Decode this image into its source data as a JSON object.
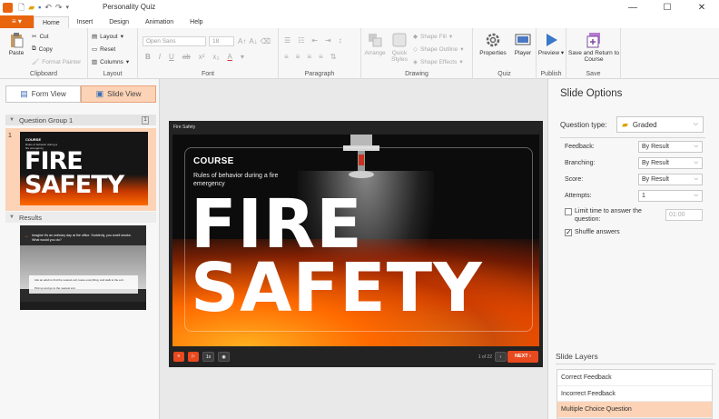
{
  "window": {
    "title": "Personality Quiz",
    "controls": [
      "—",
      "☐",
      "✕"
    ]
  },
  "tabs": {
    "file_icon": "≡",
    "items": [
      {
        "label": "Home"
      },
      {
        "label": "Insert"
      },
      {
        "label": "Design"
      },
      {
        "label": "Animation"
      },
      {
        "label": "Help"
      }
    ]
  },
  "ribbon": {
    "clipboard": {
      "label": "Clipboard",
      "paste": "Paste",
      "cut": "Cut",
      "copy": "Copy",
      "format_painter": "Format Painter"
    },
    "layout": {
      "label": "Layout",
      "layout": "Layout",
      "reset": "Reset",
      "columns": "Columns"
    },
    "font": {
      "label": "Font",
      "family": "Open Sans",
      "size": "18"
    },
    "paragraph": {
      "label": "Paragraph"
    },
    "drawing": {
      "label": "Drawing",
      "arrange": "Arrange",
      "quick_styles": "Quick Styles",
      "shape_fill": "Shape Fill",
      "shape_outline": "Shape Outline",
      "shape_effects": "Shape Effects"
    },
    "quiz": {
      "label": "Quiz",
      "properties": "Properties",
      "player": "Player"
    },
    "publish": {
      "label": "Publish",
      "preview": "Preview"
    },
    "save": {
      "label": "Save",
      "save_return": "Save and Return to Course"
    }
  },
  "left_panel": {
    "form_view": "Form View",
    "slide_view": "Slide View",
    "groups": [
      {
        "title": "Question Group 1",
        "count": "1"
      },
      {
        "title": "Results"
      }
    ],
    "slides": [
      {
        "number": "1",
        "title": "COURSE",
        "subtitle": "Rules of behavior during a fire emergency",
        "big_line1": "FIRE",
        "big_line2": "SAFETY"
      }
    ],
    "results_thumb": {
      "question": "Imagine it's an ordinary day at the office. Suddenly, you smell smoke. What would you do?",
      "option1": "Ask an adult to find the nearest exit, leave everything, and walk to the exit.",
      "option2": "Pick up and go to the nearest exit."
    }
  },
  "canvas": {
    "player_title": "Fire Safety",
    "course": "COURSE",
    "subtitle": "Rules of behavior during a fire emergency",
    "big_line1": "FIRE",
    "big_line2": "SAFETY",
    "speed": "1x",
    "pager": "1 of 22",
    "next": "NEXT"
  },
  "right_panel": {
    "title": "Slide Options",
    "question_type_label": "Question type:",
    "question_type_value": "Graded",
    "options": [
      {
        "label": "Feedback:",
        "value": "By Result"
      },
      {
        "label": "Branching:",
        "value": "By Result"
      },
      {
        "label": "Score:",
        "value": "By Result"
      },
      {
        "label": "Attempts:",
        "value": "1"
      }
    ],
    "limit_time_label": "Limit time to answer the question:",
    "limit_time_value": "01:00",
    "shuffle_label": "Shuffle answers",
    "layers_title": "Slide Layers",
    "layers": [
      {
        "label": "Correct Feedback"
      },
      {
        "label": "Incorrect Feedback"
      },
      {
        "label": "Multiple Choice Question"
      }
    ]
  },
  "colors": {
    "accent": "#e8650e",
    "selection": "#fcd3b6"
  }
}
